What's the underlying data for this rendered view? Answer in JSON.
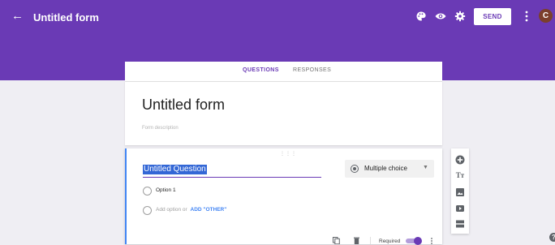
{
  "header": {
    "title": "Untitled form",
    "send_label": "SEND",
    "avatar_letter": "C",
    "icons": [
      "back-arrow-icon",
      "palette-icon",
      "eye-icon",
      "gear-icon",
      "more-vert-icon"
    ],
    "bar_color": "#6a3ab5"
  },
  "tabs": [
    {
      "label": "QUESTIONS",
      "active": true
    },
    {
      "label": "RESPONSES",
      "active": false
    }
  ],
  "form": {
    "title": "Untitled form",
    "description_placeholder": "Form description"
  },
  "question": {
    "title": "Untitled Question",
    "type": "Multiple choice",
    "options": [
      {
        "label": "Option 1"
      }
    ],
    "add_option_label": "Add option",
    "or_label": "or",
    "add_other_label": "ADD \"OTHER\"",
    "required_label": "Required",
    "required": true
  },
  "side_toolbar": {
    "icons": [
      "add-question-icon",
      "add-title-icon",
      "add-image-icon",
      "add-video-icon",
      "add-section-icon"
    ]
  },
  "help_label": "?"
}
